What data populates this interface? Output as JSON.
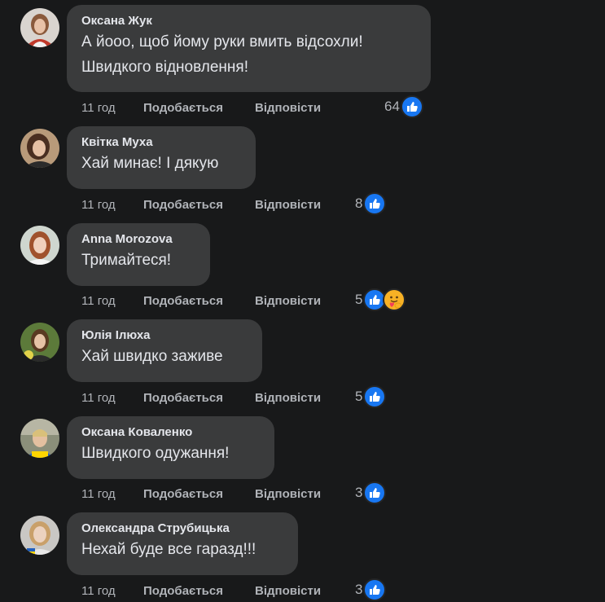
{
  "comments": [
    {
      "author": "Оксана Жук",
      "text": "А йооо, щоб йому руки вмить відсохли!\nШвидкого відновлення!",
      "time": "11 год",
      "like_label": "Подобається",
      "reply_label": "Відповісти",
      "reaction_count": "64",
      "reactions": [
        "like-icon"
      ]
    },
    {
      "author": "Квітка Муха",
      "text": "Хай минає! І дякую",
      "time": "11 год",
      "like_label": "Подобається",
      "reply_label": "Відповісти",
      "reaction_count": "8",
      "reactions": [
        "like-icon"
      ]
    },
    {
      "author": "Anna Morozova",
      "text": "Тримайтеся!",
      "time": "11 год",
      "like_label": "Подобається",
      "reply_label": "Відповісти",
      "reaction_count": "5",
      "reactions": [
        "like-icon",
        "care-icon"
      ]
    },
    {
      "author": "Юлія Ілюха",
      "text": "Хай швидко заживе",
      "time": "11 год",
      "like_label": "Подобається",
      "reply_label": "Відповісти",
      "reaction_count": "5",
      "reactions": [
        "like-icon"
      ]
    },
    {
      "author": "Оксана Коваленко",
      "text": "Швидкого одужання!",
      "time": "11 год",
      "like_label": "Подобається",
      "reply_label": "Відповісти",
      "reaction_count": "3",
      "reactions": [
        "like-icon"
      ]
    },
    {
      "author": "Олександра Струбицька",
      "text": "Нехай буде все гаразд!!!",
      "time": "11 год",
      "like_label": "Подобається",
      "reply_label": "Відповісти",
      "reaction_count": "3",
      "reactions": [
        "like-icon"
      ]
    }
  ],
  "colors": {
    "background": "#18191a",
    "bubble": "#3a3b3c",
    "primary_text": "#e4e6eb",
    "secondary_text": "#b0b3b8",
    "like_blue": "#1877f2",
    "care_yellow": "#f7b125"
  }
}
